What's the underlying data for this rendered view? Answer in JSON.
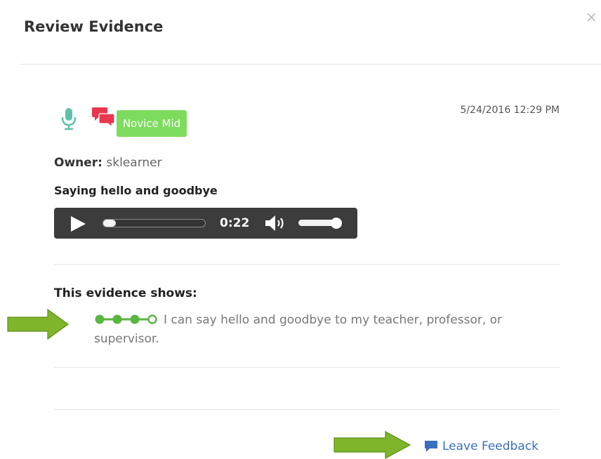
{
  "modal": {
    "title": "Review Evidence",
    "close_glyph": "×"
  },
  "evidence": {
    "icons": {
      "type_icon": "microphone-icon",
      "comment_icon": "chat-bubbles-icon"
    },
    "level_badge": "Novice Mid",
    "date": "5/24/2016 12:29 PM",
    "owner_label": "Owner:",
    "owner_value": "sklearner",
    "title": "Saying hello and goodbye",
    "audio": {
      "time": "0:22",
      "progress": 0.08,
      "volume": 0.95
    }
  },
  "shows": {
    "label": "This evidence shows:",
    "progress": {
      "filled": 3,
      "total": 4
    },
    "statement": "I can say hello and goodbye to my teacher, professor, or supervisor."
  },
  "footer": {
    "leave_feedback": "Leave Feedback"
  },
  "colors": {
    "mic": "#5fc1a9",
    "chat": "#e8384f",
    "badge": "#7ddc5e",
    "progress_dot": "#5ab543",
    "arrow": "#7fb52a",
    "link": "#3a6fbf"
  }
}
